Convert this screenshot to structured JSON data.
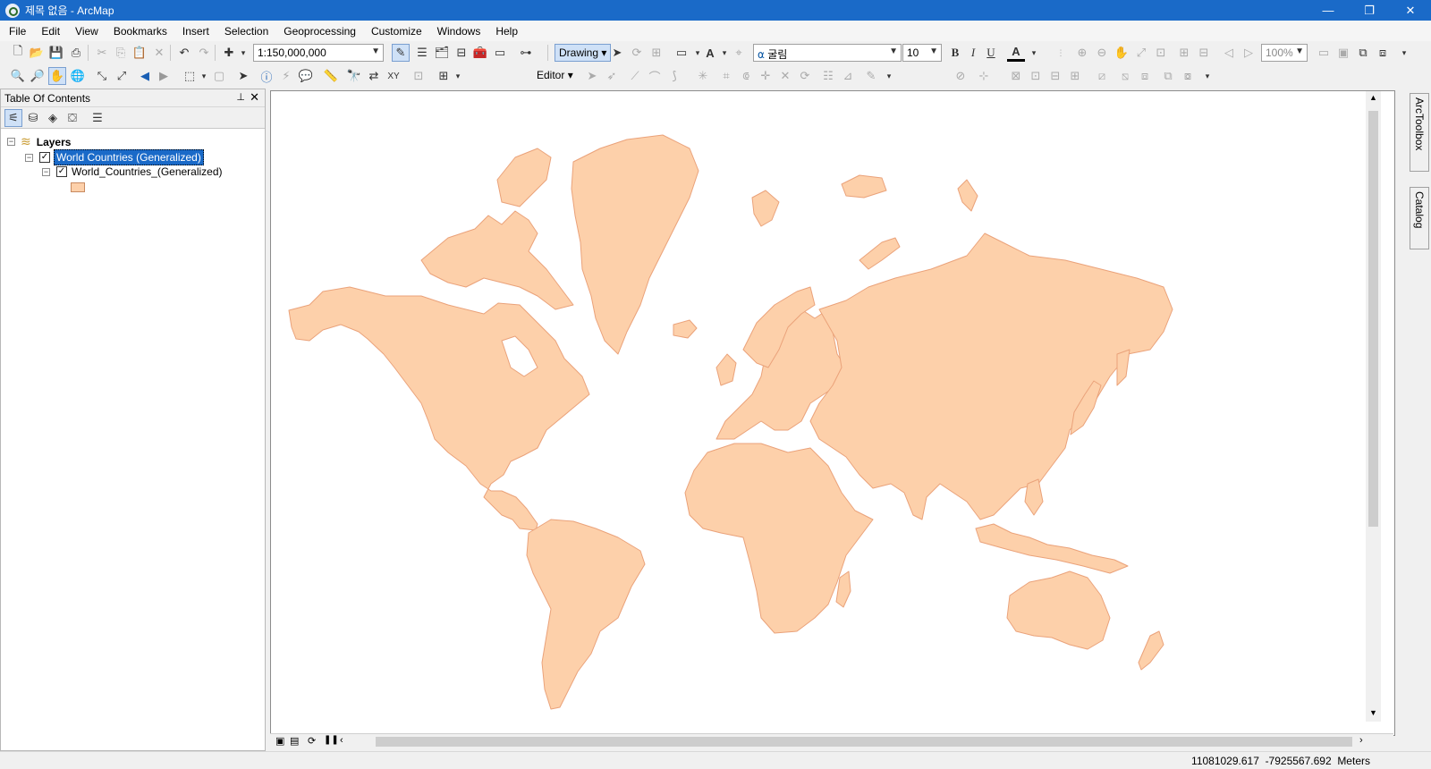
{
  "window": {
    "title": "제목 없음 - ArcMap",
    "minimize": "—",
    "maximize": "❐",
    "close": "✕"
  },
  "menu": [
    "File",
    "Edit",
    "View",
    "Bookmarks",
    "Insert",
    "Selection",
    "Geoprocessing",
    "Customize",
    "Windows",
    "Help"
  ],
  "toolbar": {
    "scale": "1:150,000,000",
    "drawing_label": "Drawing",
    "font_name": "굴림",
    "font_size": "10",
    "bold": "B",
    "italic": "I",
    "underline": "U",
    "font_color": "A",
    "zoom_percent": "100%",
    "editor_label": "Editor"
  },
  "toc": {
    "title": "Table Of Contents",
    "pin": "📌",
    "close": "✕",
    "layers_label": "Layers",
    "layer_name": "World Countries (Generalized)",
    "sublayer_name": "World_Countries_(Generalized)",
    "swatch_color": "#fdd0aa"
  },
  "side_tabs": {
    "toolbox": "ArcToolbox",
    "catalog": "Catalog"
  },
  "status": {
    "x": "11081029.617",
    "y": "-7925567.692",
    "units": "Meters"
  },
  "icons": [
    "new-icon",
    "open-icon",
    "save-icon",
    "print-icon",
    "cut-icon",
    "copy-icon",
    "paste-icon",
    "delete-icon",
    "undo-icon",
    "redo-icon",
    "add-data-icon",
    "zoom-in-icon",
    "zoom-out-icon",
    "pan-icon",
    "full-extent-icon",
    "select-icon",
    "identify-icon",
    "find-icon",
    "measure-icon"
  ]
}
